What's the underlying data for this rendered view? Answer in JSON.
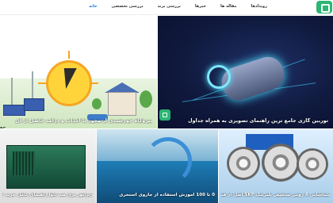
{
  "header": {
    "nav": [
      {
        "label": "خانه",
        "active": true
      },
      {
        "label": "بررسی تخصصی",
        "active": false
      },
      {
        "label": "بررسی برند",
        "active": false
      },
      {
        "label": "خبرها",
        "active": false
      },
      {
        "label": "مقاله ها",
        "active": false
      },
      {
        "label": "رویدادها",
        "active": false
      }
    ]
  },
  "hero_left": {
    "caption": "نیروگاه خورشیدی از مجوز تا احداث و درآمد حاصل از آن",
    "side_label": "EG"
  },
  "hero_right": {
    "caption": "توربین گازی جامع ترین راهنمای تصویری به همراه جداول"
  },
  "cards": [
    {
      "caption": "ژنراتور برق صد کاوا راهنمای کامل خرید + قیمت"
    },
    {
      "caption": "0 تا 100 آموزش استفاده از جاروی استخری"
    },
    {
      "caption": "شناسایی 8 روش تشخیص بلبرینگ SKF اصل از فیک"
    }
  ],
  "colors": {
    "accent": "#1a73e8",
    "brand": "#2bb673"
  }
}
